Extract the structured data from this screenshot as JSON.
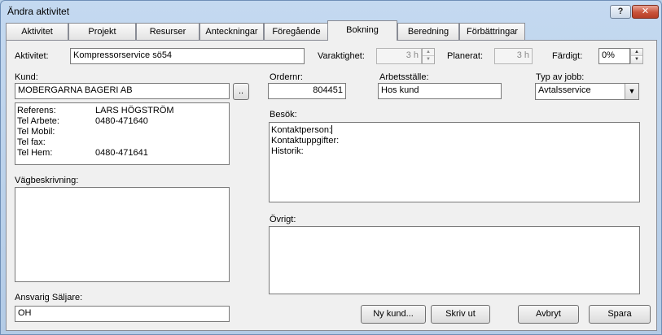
{
  "window": {
    "title": "Ändra aktivitet",
    "help": "?",
    "close": "✕"
  },
  "tabs": [
    {
      "label": "Aktivitet"
    },
    {
      "label": "Projekt"
    },
    {
      "label": "Resurser"
    },
    {
      "label": "Anteckningar"
    },
    {
      "label": "Föregående"
    },
    {
      "label": "Bokning"
    },
    {
      "label": "Beredning"
    },
    {
      "label": "Förbättringar"
    }
  ],
  "active_tab": "Bokning",
  "aktivitet": {
    "label": "Aktivitet:",
    "value": "Kompressorservice sö54",
    "varaktighet_label": "Varaktighet:",
    "varaktighet_value": "3 h",
    "planerat_label": "Planerat:",
    "planerat_value": "3 h",
    "fardigt_label": "Färdigt:",
    "fardigt_value": "0%"
  },
  "kund": {
    "label": "Kund:",
    "value": "MOBERGARNA BAGERI AB",
    "browse": "..",
    "details": [
      {
        "key": "Referens:",
        "value": "LARS HÖGSTRÖM"
      },
      {
        "key": "Tel Arbete:",
        "value": "0480-471640"
      },
      {
        "key": "Tel Mobil:",
        "value": ""
      },
      {
        "key": "Tel fax:",
        "value": ""
      },
      {
        "key": "Tel Hem:",
        "value": "0480-471641"
      }
    ]
  },
  "ordernr": {
    "label": "Ordernr:",
    "value": "804451"
  },
  "arbetsstalle": {
    "label": "Arbetsställe:",
    "value": "Hos kund"
  },
  "typ_av_jobb": {
    "label": "Typ av jobb:",
    "value": "Avtalsservice"
  },
  "besok": {
    "label": "Besök:",
    "lines": [
      "Kontaktperson:",
      "Kontaktuppgifter:",
      "Historik:"
    ]
  },
  "vagbeskrivning": {
    "label": "Vägbeskrivning:"
  },
  "ovrigt": {
    "label": "Övrigt:"
  },
  "saljare": {
    "label": "Ansvarig Säljare:",
    "value": "OH"
  },
  "buttons": {
    "ny_kund": "Ny kund...",
    "skriv_ut": "Skriv ut",
    "avbryt": "Avbryt",
    "spara": "Spara"
  }
}
